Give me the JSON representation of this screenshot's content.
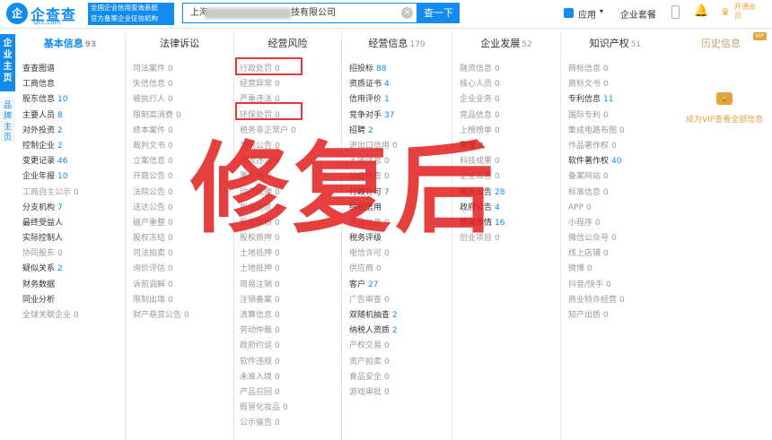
{
  "header": {
    "logo_mark": "企",
    "logo_text": "企查查",
    "logo_sub": "Qcc.com",
    "slogan_line1": "全国企业信用查询系统",
    "slogan_line2": "官方备案企业征信机构",
    "search_prefix": "上海",
    "search_suffix": "技有限公司",
    "clear_glyph": "×",
    "search_button": "查一下",
    "app_label": "应用",
    "app_caret": "▾",
    "suite_label": "企业套餐",
    "bell_glyph": "🔔",
    "vip_glyph": "♛",
    "vip_label": "开通会员"
  },
  "left_tabs": {
    "enterprise": "企业主页",
    "brand": "品牌主页"
  },
  "columns": [
    {
      "title": "基本信息",
      "count": "93",
      "active": true,
      "items": [
        {
          "label": "查查图谱",
          "count": "",
          "on": true
        },
        {
          "label": "工商信息",
          "count": "",
          "on": true
        },
        {
          "label": "股东信息",
          "count": "10",
          "on": true
        },
        {
          "label": "主要人员",
          "count": "8",
          "on": true
        },
        {
          "label": "对外投资",
          "count": "2",
          "on": true
        },
        {
          "label": "控制企业",
          "count": "2",
          "on": true
        },
        {
          "label": "变更记录",
          "count": "46",
          "on": true
        },
        {
          "label": "企业年报",
          "count": "10",
          "on": true
        },
        {
          "label": "工商自主公示",
          "count": "0",
          "on": false
        },
        {
          "label": "分支机构",
          "count": "7",
          "on": true
        },
        {
          "label": "最终受益人",
          "count": "",
          "on": true
        },
        {
          "label": "实际控制人",
          "count": "",
          "on": true
        },
        {
          "label": "协同股东",
          "count": "0",
          "on": false
        },
        {
          "label": "疑似关系",
          "count": "2",
          "on": true
        },
        {
          "label": "财务数据",
          "count": "",
          "on": true
        },
        {
          "label": "同业分析",
          "count": "",
          "on": true
        },
        {
          "label": "全球关联企业",
          "count": "0",
          "on": false
        }
      ]
    },
    {
      "title": "法律诉讼",
      "count": "",
      "active": false,
      "items": [
        {
          "label": "司法案件",
          "count": "0",
          "on": false
        },
        {
          "label": "失信信息",
          "count": "0",
          "on": false
        },
        {
          "label": "被执行人",
          "count": "0",
          "on": false
        },
        {
          "label": "限制高消费",
          "count": "0",
          "on": false
        },
        {
          "label": "终本案件",
          "count": "0",
          "on": false
        },
        {
          "label": "裁判文书",
          "count": "0",
          "on": false
        },
        {
          "label": "立案信息",
          "count": "0",
          "on": false
        },
        {
          "label": "开庭公告",
          "count": "0",
          "on": false
        },
        {
          "label": "法院公告",
          "count": "0",
          "on": false
        },
        {
          "label": "送达公告",
          "count": "0",
          "on": false
        },
        {
          "label": "破产重整",
          "count": "0",
          "on": false
        },
        {
          "label": "股权冻结",
          "count": "0",
          "on": false
        },
        {
          "label": "司法拍卖",
          "count": "0",
          "on": false
        },
        {
          "label": "询价评估",
          "count": "0",
          "on": false
        },
        {
          "label": "诉前调解",
          "count": "0",
          "on": false
        },
        {
          "label": "限制出境",
          "count": "0",
          "on": false
        },
        {
          "label": "财产悬赏公告",
          "count": "0",
          "on": false
        }
      ]
    },
    {
      "title": "经营风险",
      "count": "",
      "active": false,
      "items": [
        {
          "label": "行政处罚",
          "count": "0",
          "on": false
        },
        {
          "label": "经营异常",
          "count": "0",
          "on": false
        },
        {
          "label": "严重违法",
          "count": "0",
          "on": false
        },
        {
          "label": "环保处罚",
          "count": "0",
          "on": false
        },
        {
          "label": "税务非正常户",
          "count": "0",
          "on": false
        },
        {
          "label": "欠税公告",
          "count": "0",
          "on": false
        },
        {
          "label": "税收违法",
          "count": "0",
          "on": false
        },
        {
          "label": "黑名单",
          "count": "0",
          "on": false
        },
        {
          "label": "动产抵押",
          "count": "0",
          "on": false
        },
        {
          "label": "担保信息",
          "count": "0",
          "on": false
        },
        {
          "label": "股权出质",
          "count": "0",
          "on": false
        },
        {
          "label": "股权质押",
          "count": "0",
          "on": false
        },
        {
          "label": "土地抵押",
          "count": "0",
          "on": false
        },
        {
          "label": "土地抵押",
          "count": "0",
          "on": false
        },
        {
          "label": "简易注销",
          "count": "0",
          "on": false
        },
        {
          "label": "注销备案",
          "count": "0",
          "on": false
        },
        {
          "label": "清算信息",
          "count": "0",
          "on": false
        },
        {
          "label": "劳动仲裁",
          "count": "0",
          "on": false
        },
        {
          "label": "政府约谈",
          "count": "0",
          "on": false
        },
        {
          "label": "软件违规",
          "count": "0",
          "on": false
        },
        {
          "label": "未准入境",
          "count": "0",
          "on": false
        },
        {
          "label": "产品召回",
          "count": "0",
          "on": false
        },
        {
          "label": "假冒化妆品",
          "count": "0",
          "on": false
        },
        {
          "label": "公示催告",
          "count": "0",
          "on": false
        }
      ]
    },
    {
      "title": "经营信息",
      "count": "179",
      "active": false,
      "items": [
        {
          "label": "招投标",
          "count": "88",
          "on": true
        },
        {
          "label": "资质证书",
          "count": "4",
          "on": true
        },
        {
          "label": "信用评价",
          "count": "1",
          "on": true
        },
        {
          "label": "竞争对手",
          "count": "37",
          "on": true
        },
        {
          "label": "招聘",
          "count": "2",
          "on": true
        },
        {
          "label": "进出口信用",
          "count": "0",
          "on": false
        },
        {
          "label": "土地信息",
          "count": "0",
          "on": false
        },
        {
          "label": "抽查检查",
          "count": "0",
          "on": false
        },
        {
          "label": "行政许可",
          "count": "7",
          "on": true
        },
        {
          "label": "纳税信用",
          "count": "",
          "on": true
        },
        {
          "label": "产品信息",
          "count": "0",
          "on": false
        },
        {
          "label": "税务评级",
          "count": "",
          "on": true
        },
        {
          "label": "电信许可",
          "count": "0",
          "on": false
        },
        {
          "label": "供应商",
          "count": "0",
          "on": false
        },
        {
          "label": "客户",
          "count": "27",
          "on": true
        },
        {
          "label": "广告审查",
          "count": "0",
          "on": false
        },
        {
          "label": "双随机抽查",
          "count": "2",
          "on": true
        },
        {
          "label": "纳税人资质",
          "count": "2",
          "on": true
        },
        {
          "label": "产权交易",
          "count": "0",
          "on": false
        },
        {
          "label": "资产拍卖",
          "count": "0",
          "on": false
        },
        {
          "label": "食品安全",
          "count": "0",
          "on": false
        },
        {
          "label": "游戏审批",
          "count": "0",
          "on": false
        }
      ]
    },
    {
      "title": "企业发展",
      "count": "52",
      "active": false,
      "items": [
        {
          "label": "融资信息",
          "count": "0",
          "on": false
        },
        {
          "label": "核心人员",
          "count": "0",
          "on": false
        },
        {
          "label": "企业业务",
          "count": "0",
          "on": false
        },
        {
          "label": "竞品信息",
          "count": "0",
          "on": false
        },
        {
          "label": "上榜榜单",
          "count": "0",
          "on": false
        },
        {
          "label": "荣誉",
          "count": "4",
          "on": true
        },
        {
          "label": "科技成果",
          "count": "0",
          "on": false
        },
        {
          "label": "企业公告",
          "count": "0",
          "on": false
        },
        {
          "label": "相关公告",
          "count": "28",
          "on": true
        },
        {
          "label": "政府公告",
          "count": "4",
          "on": true
        },
        {
          "label": "新闻舆情",
          "count": "16",
          "on": true
        },
        {
          "label": "创业项目",
          "count": "0",
          "on": false
        }
      ]
    },
    {
      "title": "知识产权",
      "count": "51",
      "active": false,
      "items": [
        {
          "label": "商标信息",
          "count": "0",
          "on": false
        },
        {
          "label": "商标文书",
          "count": "0",
          "on": false
        },
        {
          "label": "专利信息",
          "count": "11",
          "on": true
        },
        {
          "label": "国际专利",
          "count": "0",
          "on": false
        },
        {
          "label": "集成电路布图",
          "count": "0",
          "on": false
        },
        {
          "label": "作品著作权",
          "count": "0",
          "on": false
        },
        {
          "label": "软件著作权",
          "count": "40",
          "on": true
        },
        {
          "label": "备案网站",
          "count": "0",
          "on": false
        },
        {
          "label": "标准信息",
          "count": "0",
          "on": false
        },
        {
          "label": "APP",
          "count": "0",
          "on": false
        },
        {
          "label": "小程序",
          "count": "0",
          "on": false
        },
        {
          "label": "微信公众号",
          "count": "0",
          "on": false
        },
        {
          "label": "线上店铺",
          "count": "0",
          "on": false
        },
        {
          "label": "微博",
          "count": "0",
          "on": false
        },
        {
          "label": "抖音/快手",
          "count": "0",
          "on": false
        },
        {
          "label": "商业特许经营",
          "count": "0",
          "on": false
        },
        {
          "label": "知产出质",
          "count": "0",
          "on": false
        }
      ]
    }
  ],
  "history": {
    "title": "历史信息",
    "vip_tag": "VIP",
    "lock_glyph": "🔒",
    "unlock_text": "成为VIP查看全部信息"
  },
  "overlay_text": "修复后",
  "colors": {
    "brand": "#128bed",
    "highlight_box": "#e53935",
    "overlay": "#e21d1d",
    "vip": "#e6a23c"
  }
}
